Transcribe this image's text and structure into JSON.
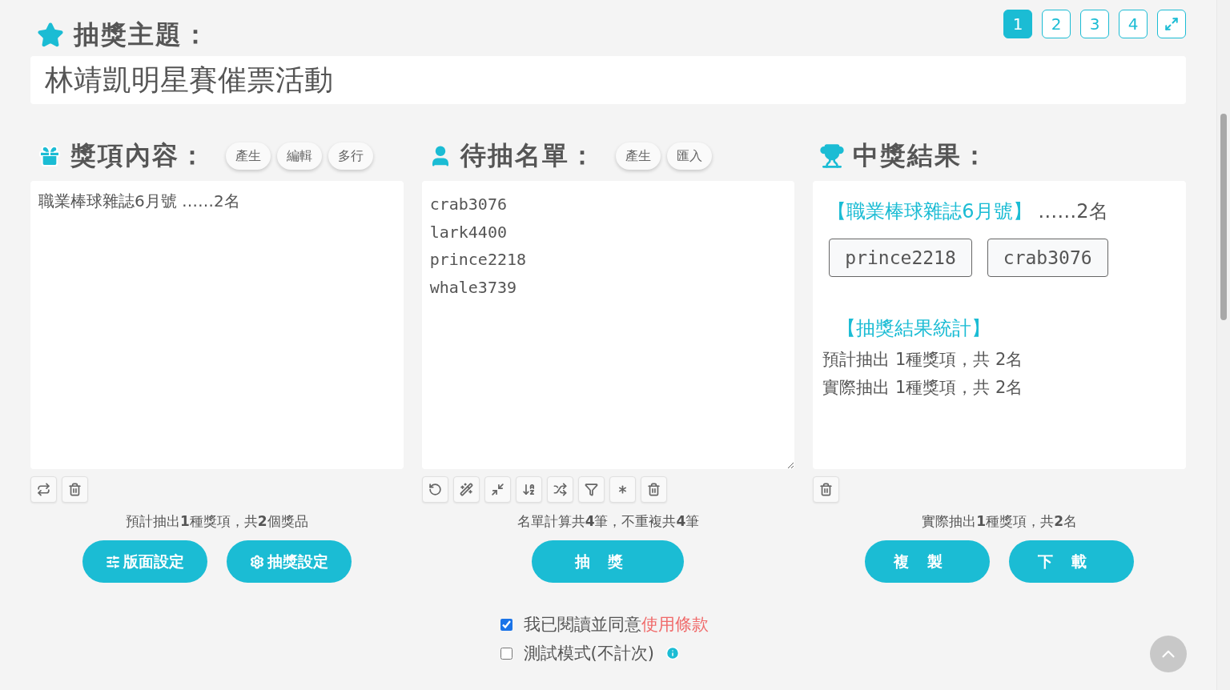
{
  "theme": {
    "label": "抽獎主題：",
    "value": "林靖凱明星賽催票活動"
  },
  "pages": [
    {
      "label": "1",
      "selected": true
    },
    {
      "label": "2",
      "selected": false
    },
    {
      "label": "3",
      "selected": false
    },
    {
      "label": "4",
      "selected": false
    }
  ],
  "prizes": {
    "title": "獎項內容：",
    "actions": [
      "產生",
      "編輯",
      "多行"
    ],
    "text": "職業棒球雜誌6月號 ……2名",
    "summary": "預計抽出**1**種獎項，共**2**個獎品",
    "buttons": [
      "版面設定",
      "抽獎設定"
    ]
  },
  "candidates": {
    "title": "待抽名單：",
    "actions": [
      "產生",
      "匯入"
    ],
    "names": [
      "crab3076",
      "lark4400",
      "prince2218",
      "whale3739"
    ],
    "summary": "名單計算共**4**筆，不重複共**4**筆",
    "button": "抽獎"
  },
  "results": {
    "title": "中獎結果：",
    "groups": [
      {
        "prize": "【職業棒球雜誌6月號】",
        "count": "……2名",
        "winners": [
          "prince2218",
          "crab3076"
        ]
      }
    ],
    "stats_title": "【抽獎結果統計】",
    "stats": [
      "預計抽出 1種獎項，共 2名",
      "實際抽出 1種獎項，共 2名"
    ],
    "summary": "實際抽出**1**種獎項，共**2**名",
    "buttons": [
      "複製",
      "下載"
    ]
  },
  "options": [
    {
      "kind": "terms",
      "checked": true,
      "text": "我已閱讀並同意",
      "link": "使用條款"
    },
    {
      "kind": "info",
      "checked": false,
      "text": "測試模式(不計次)"
    }
  ]
}
